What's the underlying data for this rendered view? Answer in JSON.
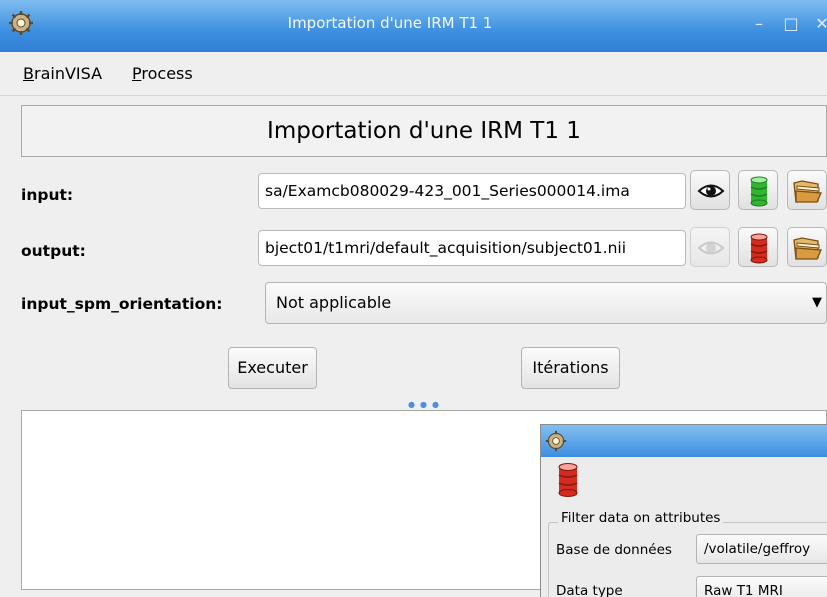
{
  "window": {
    "title": "Importation d'une IRM T1 1",
    "minimize_glyph": "–",
    "maximize_glyph": "□",
    "close_glyph": "✕"
  },
  "menubar": {
    "items": [
      {
        "label": "BrainVISA",
        "mnemonic": "B"
      },
      {
        "label": "Process",
        "mnemonic": "P"
      }
    ]
  },
  "process": {
    "title": "Importation d'une IRM T1 1",
    "params": {
      "input": {
        "label": "input:",
        "value": "sa/Examcb080029-423_001_Series000014.ima"
      },
      "output": {
        "label": "output:",
        "value": "bject01/t1mri/default_acquisition/subject01.nii"
      },
      "orientation": {
        "label": "input_spm_orientation:",
        "value": "Not applicable"
      }
    },
    "buttons": {
      "execute": "Executer",
      "iterations": "Itérations"
    }
  },
  "dialog": {
    "group_label": "Filter data on attributes",
    "rows": [
      {
        "label": "Base de données",
        "value": "/volatile/geffroy"
      },
      {
        "label": "Data type",
        "value": "Raw T1 MRI"
      }
    ]
  },
  "icons": {
    "app": "gear-icon",
    "view": "eye-icon",
    "db_green": "green-database-icon",
    "db_red": "red-database-icon",
    "browse": "folder-icon",
    "dropdown": "chevron-down-icon"
  },
  "colors": {
    "titlebar": "#3d8fe0",
    "accent": "#4c8fdc",
    "db_green": "#2fb52f",
    "db_red": "#d62a1e"
  }
}
